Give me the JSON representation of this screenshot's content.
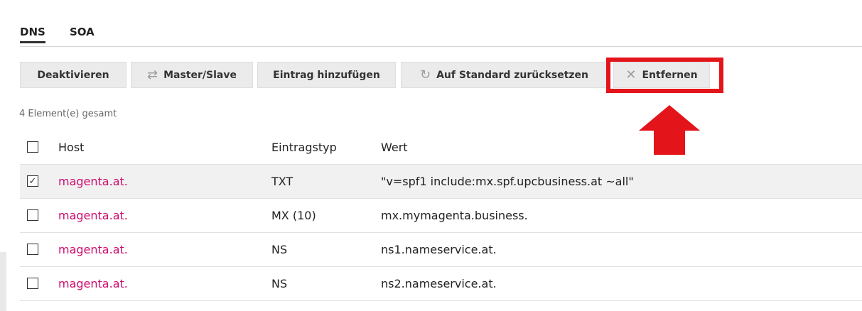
{
  "tabs": [
    {
      "label": "DNS",
      "active": true
    },
    {
      "label": "SOA",
      "active": false
    }
  ],
  "toolbar": {
    "deactivate": "Deaktivieren",
    "master_slave": "Master/Slave",
    "add_entry": "Eintrag hinzufügen",
    "reset_default": "Auf Standard zurücksetzen",
    "remove": "Entfernen"
  },
  "count_text": "4 Element(e) gesamt",
  "columns": {
    "host": "Host",
    "type": "Eintragstyp",
    "value": "Wert"
  },
  "rows": [
    {
      "host": "magenta.at.",
      "type": "TXT",
      "value": "\"v=spf1 include:mx.spf.upcbusiness.at ~all\"",
      "checked": true
    },
    {
      "host": "magenta.at.",
      "type": "MX (10)",
      "value": "mx.mymagenta.business.",
      "checked": false
    },
    {
      "host": "magenta.at.",
      "type": "NS",
      "value": "ns1.nameservice.at.",
      "checked": false
    },
    {
      "host": "magenta.at.",
      "type": "NS",
      "value": "ns2.nameservice.at.",
      "checked": false
    }
  ],
  "colors": {
    "link": "#cc0d6d",
    "highlight": "#e3151b"
  }
}
